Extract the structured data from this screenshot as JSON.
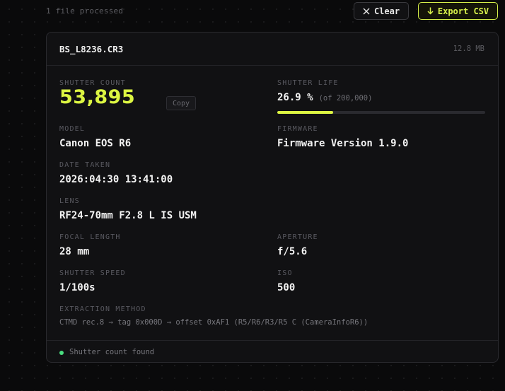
{
  "header": {
    "files_processed": "1 file processed",
    "clear_label": "Clear",
    "export_label": "Export CSV"
  },
  "colors": {
    "accent": "#dcf542",
    "background": "#0a0a0b",
    "card": "#111113",
    "status_ok": "#4ade80"
  },
  "icons": {
    "clear": "close-icon",
    "export": "download-arrow-icon",
    "status": "status-dot-icon"
  },
  "file": {
    "name": "BS_L8236.CR3",
    "size": "12.8 MB",
    "shutter_count_label": "SHUTTER COUNT",
    "shutter_count": "53,895",
    "copy_label": "Copy",
    "shutter_life_label": "SHUTTER LIFE",
    "shutter_life_pct": "26.9 %",
    "shutter_life_of": "(of 200,000)",
    "shutter_life_fraction": 0.269,
    "fields": {
      "model_label": "MODEL",
      "model": "Canon EOS R6",
      "firmware_label": "FIRMWARE",
      "firmware": "Firmware Version 1.9.0",
      "date_label": "DATE TAKEN",
      "date": "2026:04:30 13:41:00",
      "lens_label": "LENS",
      "lens": "RF24-70mm F2.8 L IS USM",
      "focal_label": "FOCAL LENGTH",
      "focal": "28 mm",
      "aperture_label": "APERTURE",
      "aperture": "f/5.6",
      "speed_label": "SHUTTER SPEED",
      "speed": "1/100s",
      "iso_label": "ISO",
      "iso": "500"
    },
    "method_label": "EXTRACTION METHOD",
    "method": "CTMD rec.8 → tag 0x000D → offset 0xAF1 (R5/R6/R3/R5 C (CameraInfoR6))",
    "status": "Shutter count found"
  }
}
